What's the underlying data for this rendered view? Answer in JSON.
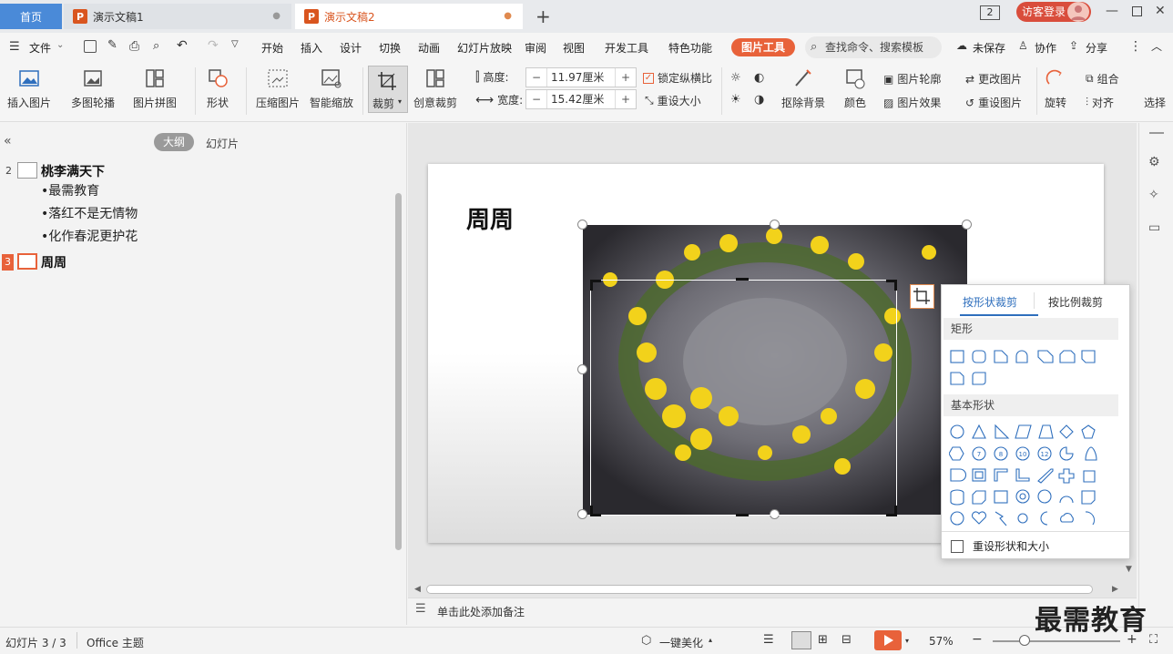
{
  "tabs": {
    "home": "首页",
    "doc1": "演示文稿1",
    "doc2": "演示文稿2",
    "logo": "P"
  },
  "titlebar": {
    "window_count": "2",
    "login": "访客登录"
  },
  "menu": {
    "file": "文件",
    "items": [
      "开始",
      "插入",
      "设计",
      "切换",
      "动画",
      "幻灯片放映",
      "审阅",
      "视图",
      "开发工具",
      "特色功能"
    ],
    "picture_tools": "图片工具",
    "search": "查找命令、搜索模板",
    "unsaved": "未保存",
    "collab": "协作",
    "share": "分享"
  },
  "ribbon": {
    "insert_picture": "插入图片",
    "multi_outline": "多图轮播",
    "collage": "图片拼图",
    "shape": "形状",
    "compress": "压缩图片",
    "smart_zoom": "智能缩放",
    "crop": "裁剪",
    "creative_crop": "创意裁剪",
    "height_label": "高度:",
    "height_value": "11.97厘米",
    "width_label": "宽度:",
    "width_value": "15.42厘米",
    "lock_ratio": "锁定纵横比",
    "reset_size": "重设大小",
    "remove_bg": "抠除背景",
    "color": "颜色",
    "pic_outline": "图片轮廓",
    "pic_effect": "图片效果",
    "change_pic": "更改图片",
    "reset_pic": "重设图片",
    "rotate": "旋转",
    "group": "组合",
    "align": "对齐",
    "select": "选择"
  },
  "outline": {
    "view_outline": "大纲",
    "view_slides": "幻灯片",
    "slide2_num": "2",
    "slide2_title": "桃李满天下",
    "bullets": [
      "•最需教育",
      "•落红不是无情物",
      "•化作春泥更护花"
    ],
    "slide3_num": "3",
    "slide3_title": "周周"
  },
  "slide": {
    "title": "周周"
  },
  "crop_popup": {
    "tab_shape": "按形状裁剪",
    "tab_ratio": "按比例裁剪",
    "section_rect": "矩形",
    "section_basic": "基本形状",
    "reset": "重设形状和大小",
    "numbers": [
      "7",
      "8",
      "10",
      "12"
    ]
  },
  "notes": {
    "placeholder": "单击此处添加备注"
  },
  "status": {
    "slide_info": "幻灯片 3 / 3",
    "theme": "Office 主题",
    "beautify": "一键美化",
    "zoom": "57%",
    "watermark": "最需教育"
  },
  "colors": {
    "accent": "#e8623a",
    "home_tab": "#4a8ad8",
    "doc_active": "#d9551f",
    "flower_yellow": "#f2d21b"
  }
}
